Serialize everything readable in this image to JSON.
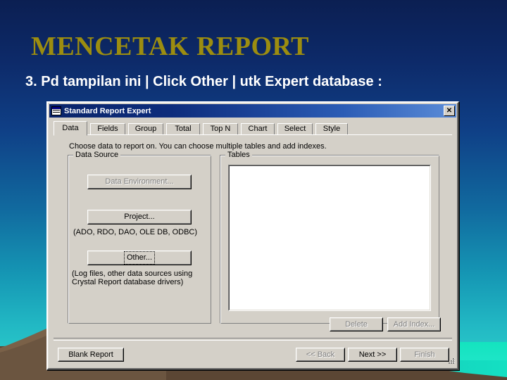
{
  "slide": {
    "title": "MENCETAK REPORT",
    "subtitle": "3. Pd tampilan ini  | Click Other  | utk Expert database :",
    "title_color": "#9c8d10",
    "subtitle_color": "#ffffff",
    "background_top_color": "#0b1f52",
    "background_bottom_color": "#2fd4cc",
    "land_color": "#5b4634",
    "sea_color": "#14e0c2"
  },
  "dialog": {
    "titlebar": {
      "icon": "report-window-icon",
      "text": "Standard Report Expert",
      "close_label": "✕",
      "gradient_start": "#0a246a",
      "gradient_end": "#5b8cd8"
    },
    "tabs": [
      {
        "label": "Data",
        "selected": true
      },
      {
        "label": "Fields",
        "selected": false
      },
      {
        "label": "Group",
        "selected": false
      },
      {
        "label": "Total",
        "selected": false
      },
      {
        "label": "Top N",
        "selected": false
      },
      {
        "label": "Chart",
        "selected": false
      },
      {
        "label": "Select",
        "selected": false
      },
      {
        "label": "Style",
        "selected": false
      }
    ],
    "instruction": "Choose data to report on. You can choose multiple tables and add indexes.",
    "data_source": {
      "legend": "Data Source",
      "data_environment_button": "Data Environment...",
      "project_button": "Project...",
      "other_button": "Other...",
      "project_hint": "(ADO, RDO, DAO, OLE DB, ODBC)",
      "other_hint_line1": "(Log files, other data sources using",
      "other_hint_line2": "Crystal Report database drivers)"
    },
    "tables": {
      "legend": "Tables",
      "items": [],
      "delete_button": "Delete",
      "add_index_button": "Add Index..."
    },
    "footer": {
      "blank_report_button": "Blank Report",
      "back_button": "<< Back",
      "next_button": "Next >>",
      "finish_button": "Finish"
    },
    "face_color": "#d4d0c8"
  }
}
